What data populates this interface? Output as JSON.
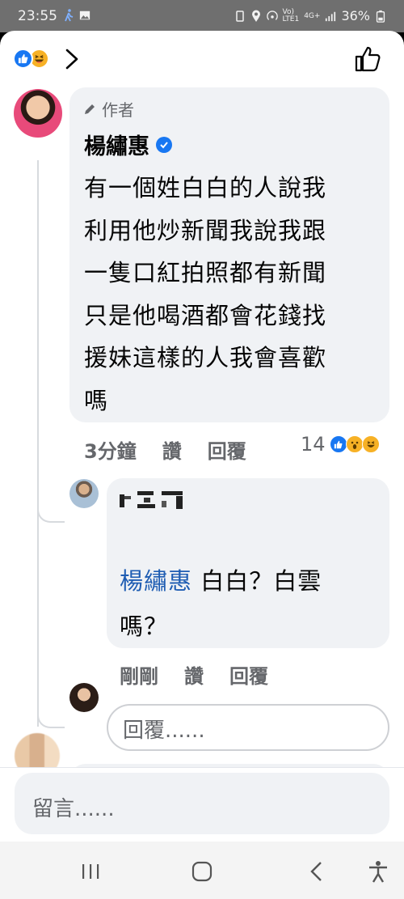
{
  "status": {
    "time": "23:55",
    "battery": "36%",
    "net": "4G+"
  },
  "comment": {
    "author_tag": "作者",
    "author_name": "楊繡惠",
    "lines": [
      "有一個姓白白的人說我",
      "利用他炒新聞我說我跟",
      "一隻口紅拍照都有新聞",
      "只是他喝酒都會花錢找",
      "援妹這樣的人我會喜歡",
      "嗎"
    ],
    "time": "3分鐘",
    "like": "讚",
    "reply": "回覆",
    "reaction_count": "14"
  },
  "reply": {
    "mention": "楊繡惠",
    "text_line1": " 白白？白雲",
    "text_line2": "嗎？",
    "time": "剛剛",
    "like": "讚",
    "reply": "回覆"
  },
  "reply_input": {
    "placeholder": "回覆......"
  },
  "comment_input": {
    "placeholder": "留言......"
  },
  "colors": {
    "accent": "#1877f2",
    "mention": "#1f5db3",
    "bubble": "#f0f2f5"
  },
  "icons": [
    "like-icon",
    "haha-icon",
    "wow-icon",
    "chevron-right-icon",
    "thumbs-up-icon",
    "pencil-icon",
    "verified-badge-icon",
    "recents-icon",
    "home-icon",
    "back-icon",
    "accessibility-icon"
  ]
}
